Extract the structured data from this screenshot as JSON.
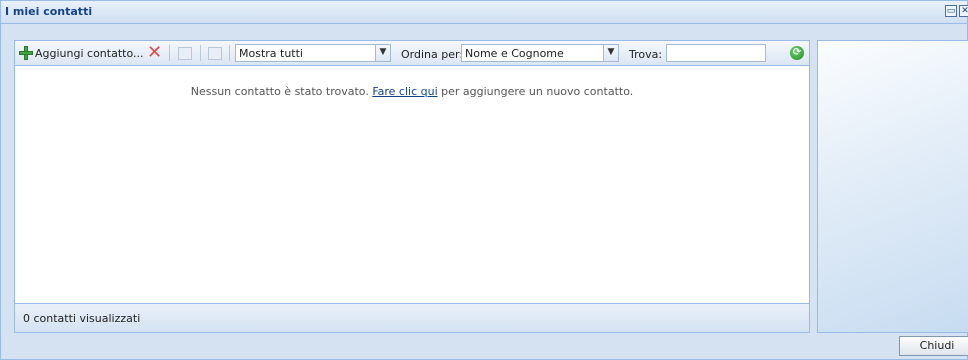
{
  "window": {
    "title": "I miei contatti",
    "controls": [
      {
        "icon": "maximize-icon"
      },
      {
        "icon": "close-icon"
      }
    ]
  },
  "toolbar": {
    "add_label": "Aggiungi contatto...",
    "delete_icon": "delete-x-icon",
    "filter_select": "Mostra tutti",
    "sort_label": "Ordina per:",
    "sort_select": "Nome e Cognome",
    "search_label": "Trova:",
    "search_value": ""
  },
  "content": {
    "empty_prefix": "Nessun contatto è stato trovato.",
    "empty_link": "Fare clic qui",
    "empty_suffix": "per aggiungere un nuovo contatto."
  },
  "status": {
    "count_text": "0 contatti visualizzati"
  },
  "footer": {
    "close_label": "Chiudi"
  },
  "colors": {
    "title": "#15428b",
    "border": "#99bbe8",
    "panel_bg": "#d4e2f2"
  }
}
